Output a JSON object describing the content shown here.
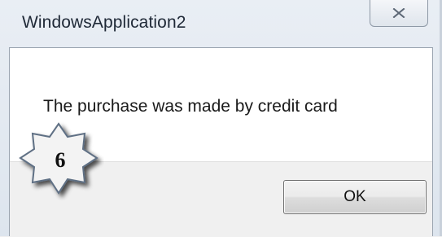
{
  "window": {
    "title": "WindowsApplication2",
    "close_icon": "close-x-icon"
  },
  "dialog": {
    "message": "The purchase was made by credit card",
    "ok_label": "OK"
  },
  "overlay": {
    "step_badge": "6",
    "badge_shape": "eight-point-star",
    "badge_fill": "#f3f3f3",
    "badge_shadow": "#5f6f84"
  }
}
